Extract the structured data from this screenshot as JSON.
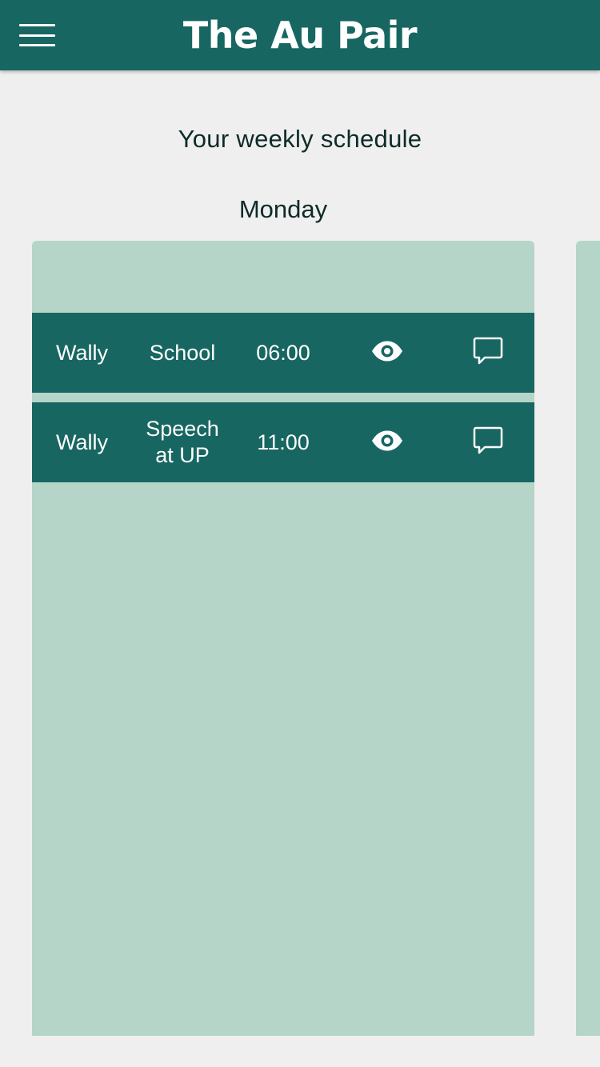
{
  "header": {
    "app_title": "The Au Pair",
    "menu_icon": "hamburger-menu-icon",
    "background_color": "#176661"
  },
  "page": {
    "heading": "Your weekly schedule"
  },
  "schedule": {
    "day": "Monday",
    "events": [
      {
        "child": "Wally",
        "activity": "School",
        "time": "06:00",
        "view_icon": "eye-icon",
        "comment_icon": "chat-bubble-icon"
      },
      {
        "child": "Wally",
        "activity": "Speech at UP",
        "time": "11:00",
        "view_icon": "eye-icon",
        "comment_icon": "chat-bubble-icon"
      }
    ]
  },
  "colors": {
    "primary": "#176661",
    "card_background": "#b5d5c9",
    "page_background": "#efefef",
    "heading_text": "#0d2b28"
  }
}
